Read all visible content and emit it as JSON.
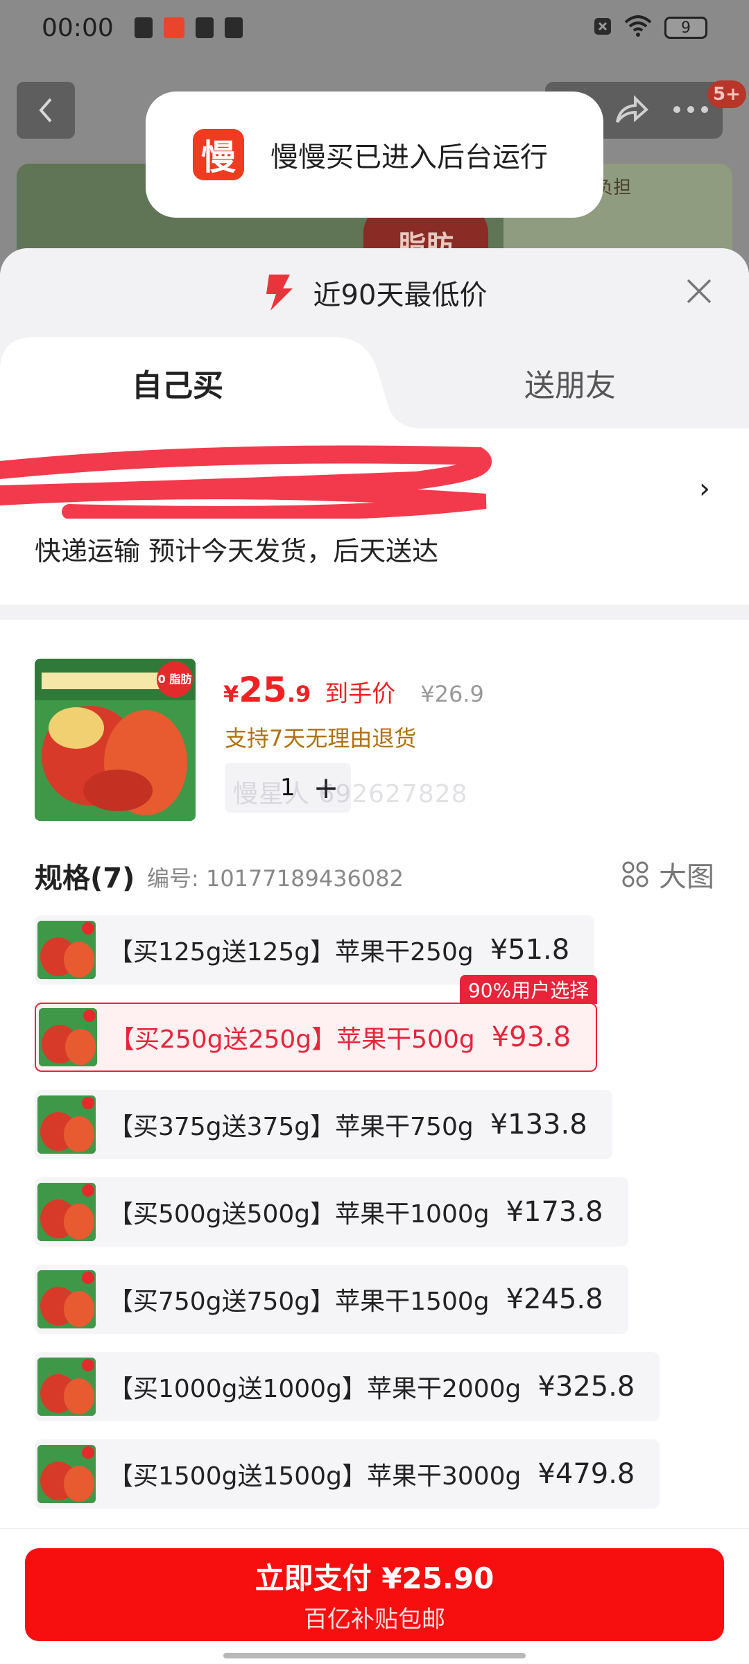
{
  "status_bar": {
    "time": "00:00",
    "battery": "9"
  },
  "background": {
    "badge": "5+",
    "promo_text": "不添加 轻负担",
    "fat_text": "脂肪"
  },
  "toast": {
    "logo_char": "慢",
    "message": "慢慢买已进入后台运行"
  },
  "sheet": {
    "header_title": "近90天最低价",
    "tabs": [
      {
        "label": "自己买",
        "active": true
      },
      {
        "label": "送朋友",
        "active": false
      }
    ],
    "delivery_text": "快递运输 预计今天发货，后天送达",
    "address_chevron": "›"
  },
  "product": {
    "fat_badge": "0 脂肪",
    "price_symbol": "¥",
    "price_int": "25",
    "price_dec": ".9",
    "price_label": "到手价",
    "original_price": "¥26.9",
    "return_policy": "支持7天无理由退货",
    "quantity": "1",
    "plus": "+",
    "watermark": "慢星人 692627828"
  },
  "spec": {
    "title": "规格(7)",
    "code": "编号: 10177189436082",
    "big_pic_label": "大图",
    "items": [
      {
        "label": "【买125g送125g】苹果干250g",
        "price": "¥51.8"
      },
      {
        "label": "【买250g送250g】苹果干500g",
        "price": "¥93.8",
        "tag": "90%用户选择",
        "selected": true
      },
      {
        "label": "【买375g送375g】苹果干750g",
        "price": "¥133.8"
      },
      {
        "label": "【买500g送500g】苹果干1000g",
        "price": "¥173.8"
      },
      {
        "label": "【买750g送750g】苹果干1500g",
        "price": "¥245.8"
      },
      {
        "label": "【买1000g送1000g】苹果干2000g",
        "price": "¥325.8"
      },
      {
        "label": "【买1500g送1500g】苹果干3000g",
        "price": "¥479.8"
      }
    ]
  },
  "pay": {
    "main": "立即支付 ¥25.90",
    "sub": "百亿补贴包邮"
  },
  "colors": {
    "accent": "#f70f0f",
    "selected_border": "#e8243a",
    "return_text": "#b0700e"
  }
}
